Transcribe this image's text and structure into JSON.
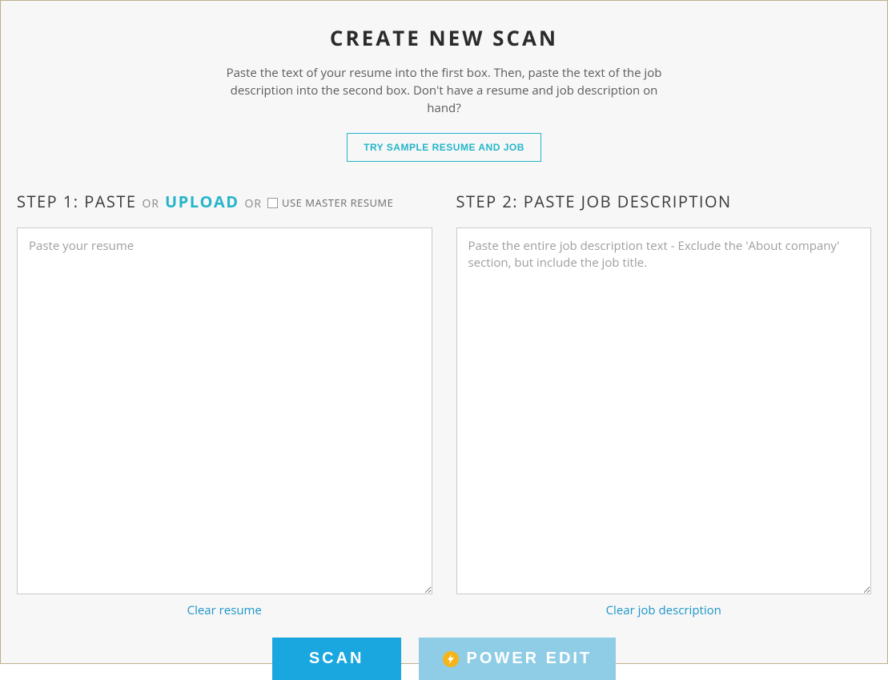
{
  "header": {
    "title": "CREATE NEW SCAN",
    "instructions": "Paste the text of your resume into the first box. Then, paste the text of the job description into the second box. Don't have a resume and job description on hand?",
    "try_sample_label": "TRY SAMPLE RESUME AND JOB"
  },
  "step1": {
    "label_prefix": "STEP 1: PASTE",
    "or_text": "OR",
    "upload_label": "UPLOAD",
    "master_resume_label": "USE MASTER RESUME",
    "textarea_placeholder": "Paste your resume",
    "clear_label": "Clear resume"
  },
  "step2": {
    "label": "STEP 2: PASTE JOB DESCRIPTION",
    "textarea_placeholder": "Paste the entire job description text - Exclude the 'About company' section, but include the job title.",
    "clear_label": "Clear job description"
  },
  "actions": {
    "scan_label": "SCAN",
    "power_edit_label": "POWER EDIT"
  }
}
